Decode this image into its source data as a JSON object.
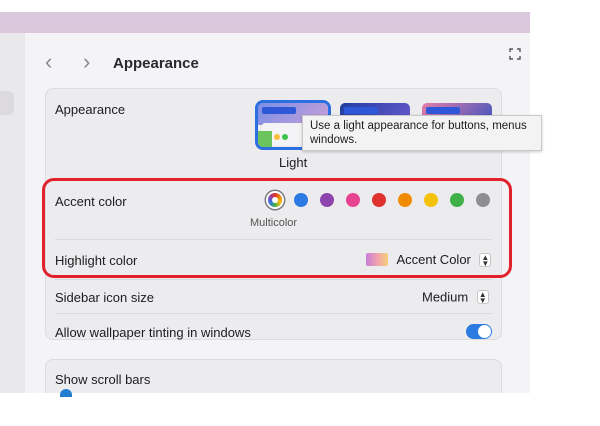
{
  "window": {
    "title": "Appearance"
  },
  "appearance_group": {
    "label": "Appearance",
    "thumbnail_selected_label": "Light",
    "tooltip": "Use a light appearance for buttons, menus, and windows.",
    "tooltip_line1": "Use a light appearance for buttons, menus",
    "tooltip_line2": "windows."
  },
  "accent": {
    "label": "Accent color",
    "selected_name": "Multicolor",
    "colors": [
      "multicolor",
      "#2c7be5",
      "#8e44ad",
      "#e84393",
      "#e03131",
      "#f08c00",
      "#f5c20b",
      "#40b049",
      "#8e8e93"
    ]
  },
  "highlight": {
    "label": "Highlight color",
    "value": "Accent Color"
  },
  "sidebar_icon_size": {
    "label": "Sidebar icon size",
    "value": "Medium"
  },
  "wallpaper_tinting": {
    "label": "Allow wallpaper tinting in windows",
    "enabled": true
  },
  "scroll_bars": {
    "label": "Show scroll bars"
  },
  "colors": {
    "accent_blue": "#2b6fe0",
    "annotation_red": "#e0222c"
  }
}
